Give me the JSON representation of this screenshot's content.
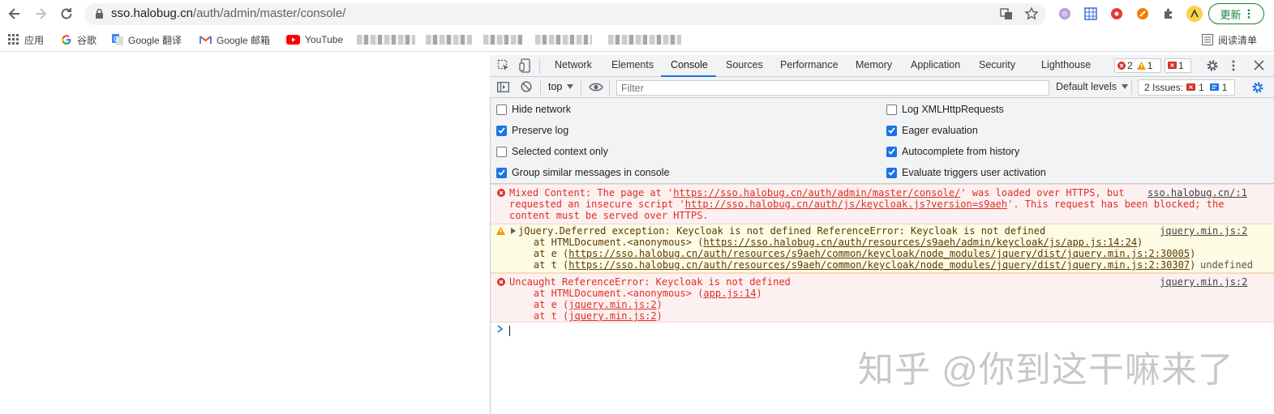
{
  "browser": {
    "url_host": "sso.halobug.cn",
    "url_path": "/auth/admin/master/console/",
    "update_label": "更新",
    "colors": {
      "update_green": "#188038",
      "accent_blue": "#1a73e8"
    }
  },
  "bookmarks": {
    "apps": "应用",
    "items": [
      "谷歌",
      "Google 翻译",
      "Google 邮箱",
      "YouTube"
    ],
    "reading_list": "阅读清单"
  },
  "devtools": {
    "tabs": [
      "Network",
      "Elements",
      "Console",
      "Sources",
      "Performance",
      "Memory",
      "Application",
      "Security",
      "Lighthouse"
    ],
    "active_tab": "Console",
    "badges": {
      "errors": "2",
      "warnings": "1",
      "issues": "1"
    },
    "toolbar": {
      "context": "top",
      "filter_placeholder": "Filter",
      "levels": "Default levels",
      "issues_label": "2 Issues:",
      "issues_errors": "1",
      "issues_info": "1"
    },
    "settings": {
      "left": [
        {
          "label": "Hide network",
          "checked": false
        },
        {
          "label": "Preserve log",
          "checked": true
        },
        {
          "label": "Selected context only",
          "checked": false
        },
        {
          "label": "Group similar messages in console",
          "checked": true
        }
      ],
      "right": [
        {
          "label": "Log XMLHttpRequests",
          "checked": false
        },
        {
          "label": "Eager evaluation",
          "checked": true
        },
        {
          "label": "Autocomplete from history",
          "checked": true
        },
        {
          "label": "Evaluate triggers user activation",
          "checked": true
        }
      ]
    },
    "messages": {
      "mixed": {
        "l1a": "Mixed Content: The page at '",
        "l1link": "https://sso.halobug.cn/auth/admin/master/console/",
        "l1b": "' was loaded over HTTPS, but",
        "l2a": "requested an insecure script '",
        "l2link": "http://sso.halobug.cn/auth/js/keycloak.js?version=s9aeh",
        "l2b": "'. This request has been blocked; the",
        "l3": "content must be served over HTTPS.",
        "source": "sso.halobug.cn/:1"
      },
      "warn": {
        "l1": "jQuery.Deferred exception: Keycloak is not defined ReferenceError: Keycloak is not defined",
        "l2a": "    at HTMLDocument.<anonymous> (",
        "l2link": "https://sso.halobug.cn/auth/resources/s9aeh/admin/keycloak/js/app.js:14:24",
        "l2b": ")",
        "l3a": "    at e (",
        "l3link": "https://sso.halobug.cn/auth/resources/s9aeh/common/keycloak/node_modules/jquery/dist/jquery.min.js:2:30005",
        "l3b": ")",
        "l4a": "    at t (",
        "l4link": "https://sso.halobug.cn/auth/resources/s9aeh/common/keycloak/node_modules/jquery/dist/jquery.min.js:2:30307",
        "l4b": ")",
        "tail": "undefined",
        "source": "jquery.min.js:2"
      },
      "uncaught": {
        "l1": "Uncaught ReferenceError: Keycloak is not defined",
        "l2a": "    at HTMLDocument.<anonymous> (",
        "l2link": "app.js:14",
        "l2b": ")",
        "l3a": "    at e (",
        "l3link": "jquery.min.js:2",
        "l3b": ")",
        "l4a": "    at t (",
        "l4link": "jquery.min.js:2",
        "l4b": ")",
        "source": "jquery.min.js:2"
      }
    }
  },
  "watermark": "知乎 @你到这干嘛来了"
}
